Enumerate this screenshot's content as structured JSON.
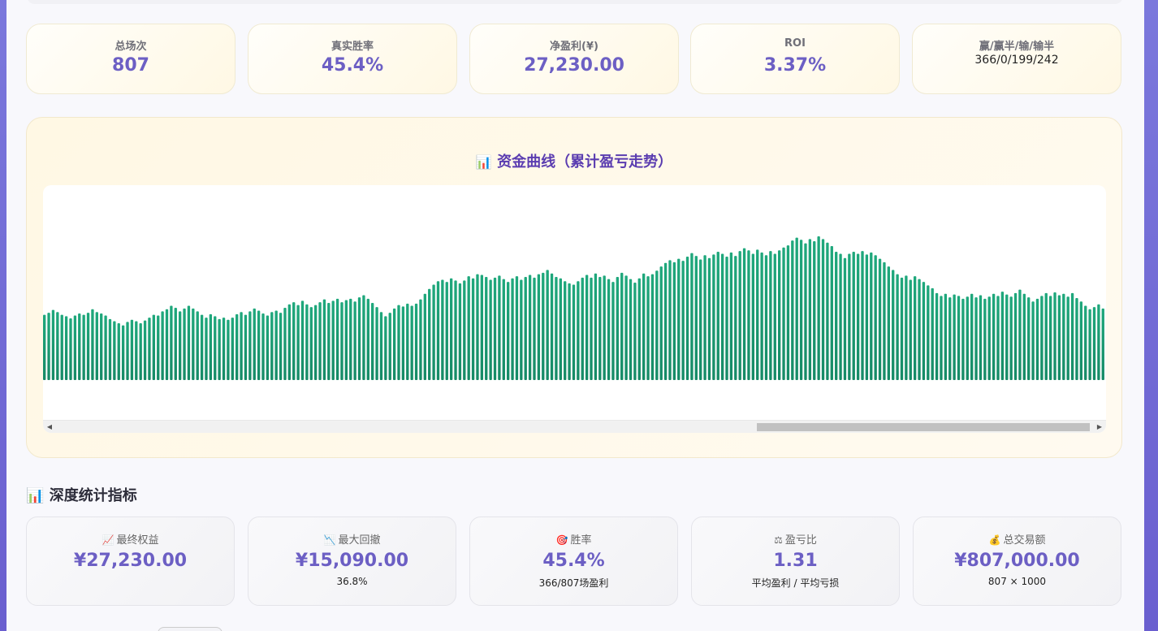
{
  "summary": [
    {
      "label": "总场次",
      "value": "807"
    },
    {
      "label": "真实胜率",
      "value": "45.4%"
    },
    {
      "label": "净盈利(¥)",
      "value": "27,230.00"
    },
    {
      "label": "ROI",
      "value": "3.37%"
    },
    {
      "label": "赢/赢半/输/输半",
      "value": "366/0/199/242"
    }
  ],
  "chart": {
    "icon": "bar-chart-icon",
    "title_icon": "📊",
    "title": "资金曲线（累计盈亏走势）"
  },
  "chart_data": {
    "type": "bar",
    "title": "资金曲线（累计盈亏走势）",
    "bar_color": "#1fa87c",
    "bar_color_dark": "#168a66",
    "values": [
      9.3,
      9.6,
      10.0,
      9.7,
      9.3,
      9.1,
      8.8,
      9.2,
      9.5,
      9.3,
      9.6,
      10.1,
      9.7,
      9.5,
      9.2,
      8.7,
      8.4,
      8.1,
      7.8,
      8.3,
      8.6,
      8.4,
      8.1,
      8.5,
      8.9,
      9.3,
      9.2,
      9.8,
      10.1,
      10.6,
      10.3,
      9.8,
      10.2,
      10.6,
      10.2,
      9.8,
      9.3,
      8.9,
      9.4,
      9.1,
      8.7,
      8.9,
      8.6,
      8.9,
      9.4,
      9.7,
      9.3,
      9.8,
      10.2,
      9.9,
      9.5,
      9.2,
      9.7,
      9.9,
      9.6,
      10.3,
      10.8,
      11.1,
      10.7,
      11.3,
      10.8,
      10.4,
      10.7,
      11.1,
      11.5,
      11.0,
      11.3,
      11.6,
      11.1,
      11.4,
      11.6,
      11.2,
      11.8,
      12.1,
      11.6,
      11.0,
      10.4,
      9.7,
      9.1,
      9.6,
      10.2,
      10.7,
      10.5,
      10.9,
      10.6,
      10.9,
      11.5,
      12.3,
      13.0,
      13.6,
      14.1,
      14.3,
      14.0,
      14.5,
      14.2,
      13.8,
      14.2,
      14.8,
      14.5,
      15.1,
      15.0,
      14.7,
      14.3,
      14.6,
      14.9,
      14.4,
      14.0,
      14.5,
      14.8,
      14.3,
      14.7,
      15.0,
      14.6,
      15.1,
      15.3,
      15.7,
      15.2,
      14.7,
      14.5,
      14.1,
      13.8,
      13.6,
      14.1,
      14.6,
      15.0,
      14.6,
      15.2,
      14.7,
      14.9,
      14.4,
      14.0,
      14.7,
      15.3,
      14.9,
      14.4,
      13.9,
      14.5,
      15.2,
      14.8,
      15.1,
      15.6,
      16.2,
      16.7,
      17.1,
      16.8,
      17.3,
      17.0,
      17.6,
      18.1,
      17.7,
      17.2,
      17.8,
      17.4,
      17.9,
      18.3,
      18.0,
      17.6,
      18.2,
      17.7,
      18.4,
      18.8,
      18.5,
      18.0,
      18.6,
      18.2,
      17.8,
      18.4,
      18.0,
      18.5,
      18.9,
      19.2,
      19.9,
      20.3,
      20.0,
      19.5,
      20.1,
      19.8,
      20.5,
      20.1,
      19.6,
      19.1,
      18.3,
      18.0,
      17.4,
      18.0,
      18.3,
      18.0,
      18.4,
      17.9,
      18.2,
      17.8,
      17.3,
      16.8,
      16.2,
      15.7,
      15.1,
      14.6,
      14.9,
      14.3,
      14.8,
      14.4,
      14.0,
      13.5,
      13.1,
      12.4,
      12.0,
      12.3,
      11.8,
      12.2,
      12.0,
      11.6,
      11.9,
      12.3,
      11.8,
      12.1,
      11.6,
      11.9,
      12.3,
      12.0,
      12.6,
      12.2,
      11.9,
      12.4,
      12.9,
      12.3,
      11.8,
      11.2,
      11.6,
      12.0,
      12.4,
      12.0,
      12.5,
      12.1,
      12.3,
      11.9,
      12.4,
      11.7,
      11.2,
      10.6,
      10.1,
      10.4,
      10.8,
      10.2
    ]
  },
  "section": {
    "icon": "bar-chart-icon",
    "icon_glyph": "📊",
    "title": "深度统计指标"
  },
  "metrics": [
    {
      "icon": "chart-up-icon",
      "icon_glyph": "📈",
      "label": "最终权益",
      "value": "¥27,230.00",
      "sub": ""
    },
    {
      "icon": "chart-down-icon",
      "icon_glyph": "📉",
      "label": "最大回撤",
      "value": "¥15,090.00",
      "sub": "36.8%"
    },
    {
      "icon": "target-icon",
      "icon_glyph": "🎯",
      "label": "胜率",
      "value": "45.4%",
      "sub": "366/807场盈利"
    },
    {
      "icon": "balance-scale-icon",
      "icon_glyph": "⚖",
      "label": "盈亏比",
      "value": "1.31",
      "sub": "平均盈利 / 平均亏损"
    },
    {
      "icon": "money-bag-icon",
      "icon_glyph": "💰",
      "label": "总交易额",
      "value": "¥807,000.00",
      "sub": "807 × 1000"
    }
  ]
}
